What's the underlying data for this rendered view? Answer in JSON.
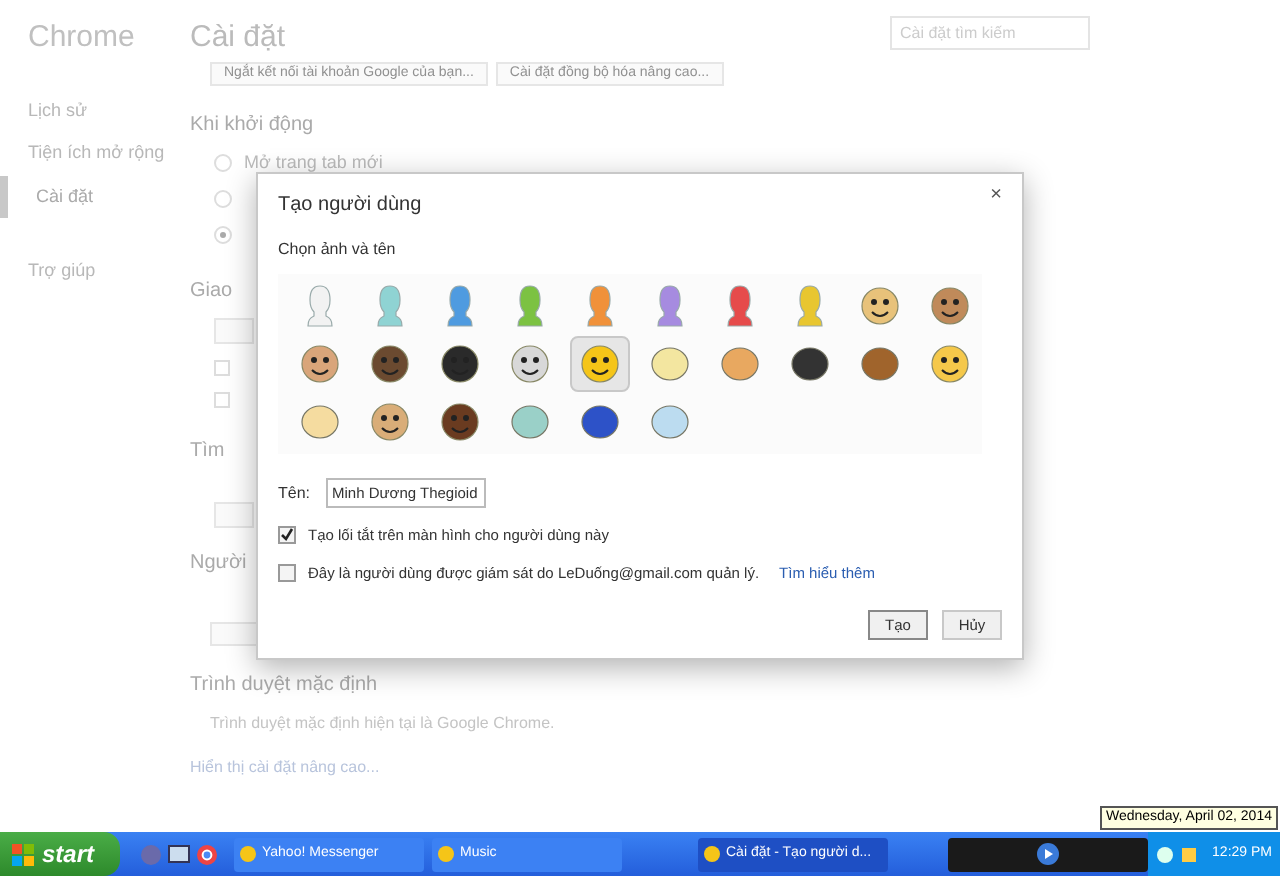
{
  "background": {
    "brand": "Chrome",
    "nav": [
      {
        "label": "Lịch sử",
        "selected": false
      },
      {
        "label": "Tiện ích mở rộng",
        "selected": false
      },
      {
        "label": "Cài đặt",
        "selected": true
      },
      {
        "label": "Trợ giúp",
        "selected": false
      }
    ],
    "title": "Cài đặt",
    "search": {
      "placeholder": "Cài đặt tìm kiếm"
    },
    "top_buttons": [
      "Ngắt kết nối tài khoản Google của bạn...",
      "Cài đặt đồng bộ hóa nâng cao..."
    ],
    "startup": {
      "heading": "Khi khởi động",
      "options": [
        {
          "label": "Mở trang tab mới",
          "selected": false
        },
        {
          "selected": false
        },
        {
          "selected": true
        }
      ]
    },
    "partial_headings": [
      "Giao",
      "Tìm",
      "Người"
    ],
    "appearance_checks": [
      {
        "checked": false
      },
      {
        "checked": false
      }
    ],
    "default_browser": {
      "heading": "Trình duyệt mặc định",
      "text": "Trình duyệt mặc định hiện tại là Google Chrome."
    },
    "advanced_link": "Hiển thị cài đặt nâng cao..."
  },
  "dialog": {
    "title": "Tạo người dùng",
    "close": "×",
    "subtitle": "Chọn ảnh và tên",
    "avatars": [
      {
        "kind": "head",
        "color": "#f2f2f2",
        "selected": false
      },
      {
        "kind": "head",
        "color": "#8fd3d3",
        "selected": false
      },
      {
        "kind": "head",
        "color": "#4f9be0",
        "selected": false
      },
      {
        "kind": "head",
        "color": "#7cc242",
        "selected": false
      },
      {
        "kind": "head",
        "color": "#f0913a",
        "selected": false
      },
      {
        "kind": "head",
        "color": "#a68be0",
        "selected": false
      },
      {
        "kind": "head",
        "color": "#e64b4b",
        "selected": false
      },
      {
        "kind": "head",
        "color": "#e8c630",
        "selected": false
      },
      {
        "kind": "face",
        "color": "#e8c27a",
        "selected": false
      },
      {
        "kind": "face",
        "color": "#c08a5a",
        "selected": false
      },
      {
        "kind": "face",
        "color": "#d9a57a",
        "selected": false
      },
      {
        "kind": "face",
        "color": "#6b4a30",
        "selected": false
      },
      {
        "kind": "face",
        "color": "#2a2a2a",
        "selected": false
      },
      {
        "kind": "face",
        "color": "#d8d8d8",
        "selected": false
      },
      {
        "kind": "face",
        "color": "#f5c518",
        "selected": true
      },
      {
        "kind": "object",
        "color": "#f3e6a0",
        "selected": false
      },
      {
        "kind": "object",
        "color": "#e8a860",
        "selected": false
      },
      {
        "kind": "object",
        "color": "#333333",
        "selected": false
      },
      {
        "kind": "object",
        "color": "#a0642c",
        "selected": false
      },
      {
        "kind": "face",
        "color": "#f5c84a",
        "selected": false
      },
      {
        "kind": "object",
        "color": "#f5dca0",
        "selected": false
      },
      {
        "kind": "face",
        "color": "#d9ad78",
        "selected": false
      },
      {
        "kind": "face",
        "color": "#6a3b20",
        "selected": false
      },
      {
        "kind": "object",
        "color": "#9ad0c8",
        "selected": false
      },
      {
        "kind": "object",
        "color": "#2d52c8",
        "selected": false
      },
      {
        "kind": "object",
        "color": "#bcdcf0",
        "selected": false
      }
    ],
    "name_label": "Tên:",
    "name_value": "Minh Dương Thegioid",
    "options": [
      {
        "label": "Tạo lối tắt trên màn hình cho người dùng này",
        "checked": true
      },
      {
        "label": "Đây là người dùng được giám sát do LeDuống@gmail.com quản lý.",
        "link": "Tìm hiểu thêm",
        "checked": false
      }
    ],
    "buttons": [
      {
        "label": "Tạo",
        "default": true
      },
      {
        "label": "Hủy",
        "default": false
      }
    ]
  },
  "taskbar": {
    "start": "start",
    "tasks": [
      {
        "label": "Yahoo! Messenger",
        "selected": false
      },
      {
        "label": "Music",
        "selected": false
      },
      {
        "label": "Cài đặt - Tạo người d...",
        "selected": true
      }
    ],
    "clock": "12:29 PM",
    "tooltip": "Wednesday, April 02, 2014"
  }
}
